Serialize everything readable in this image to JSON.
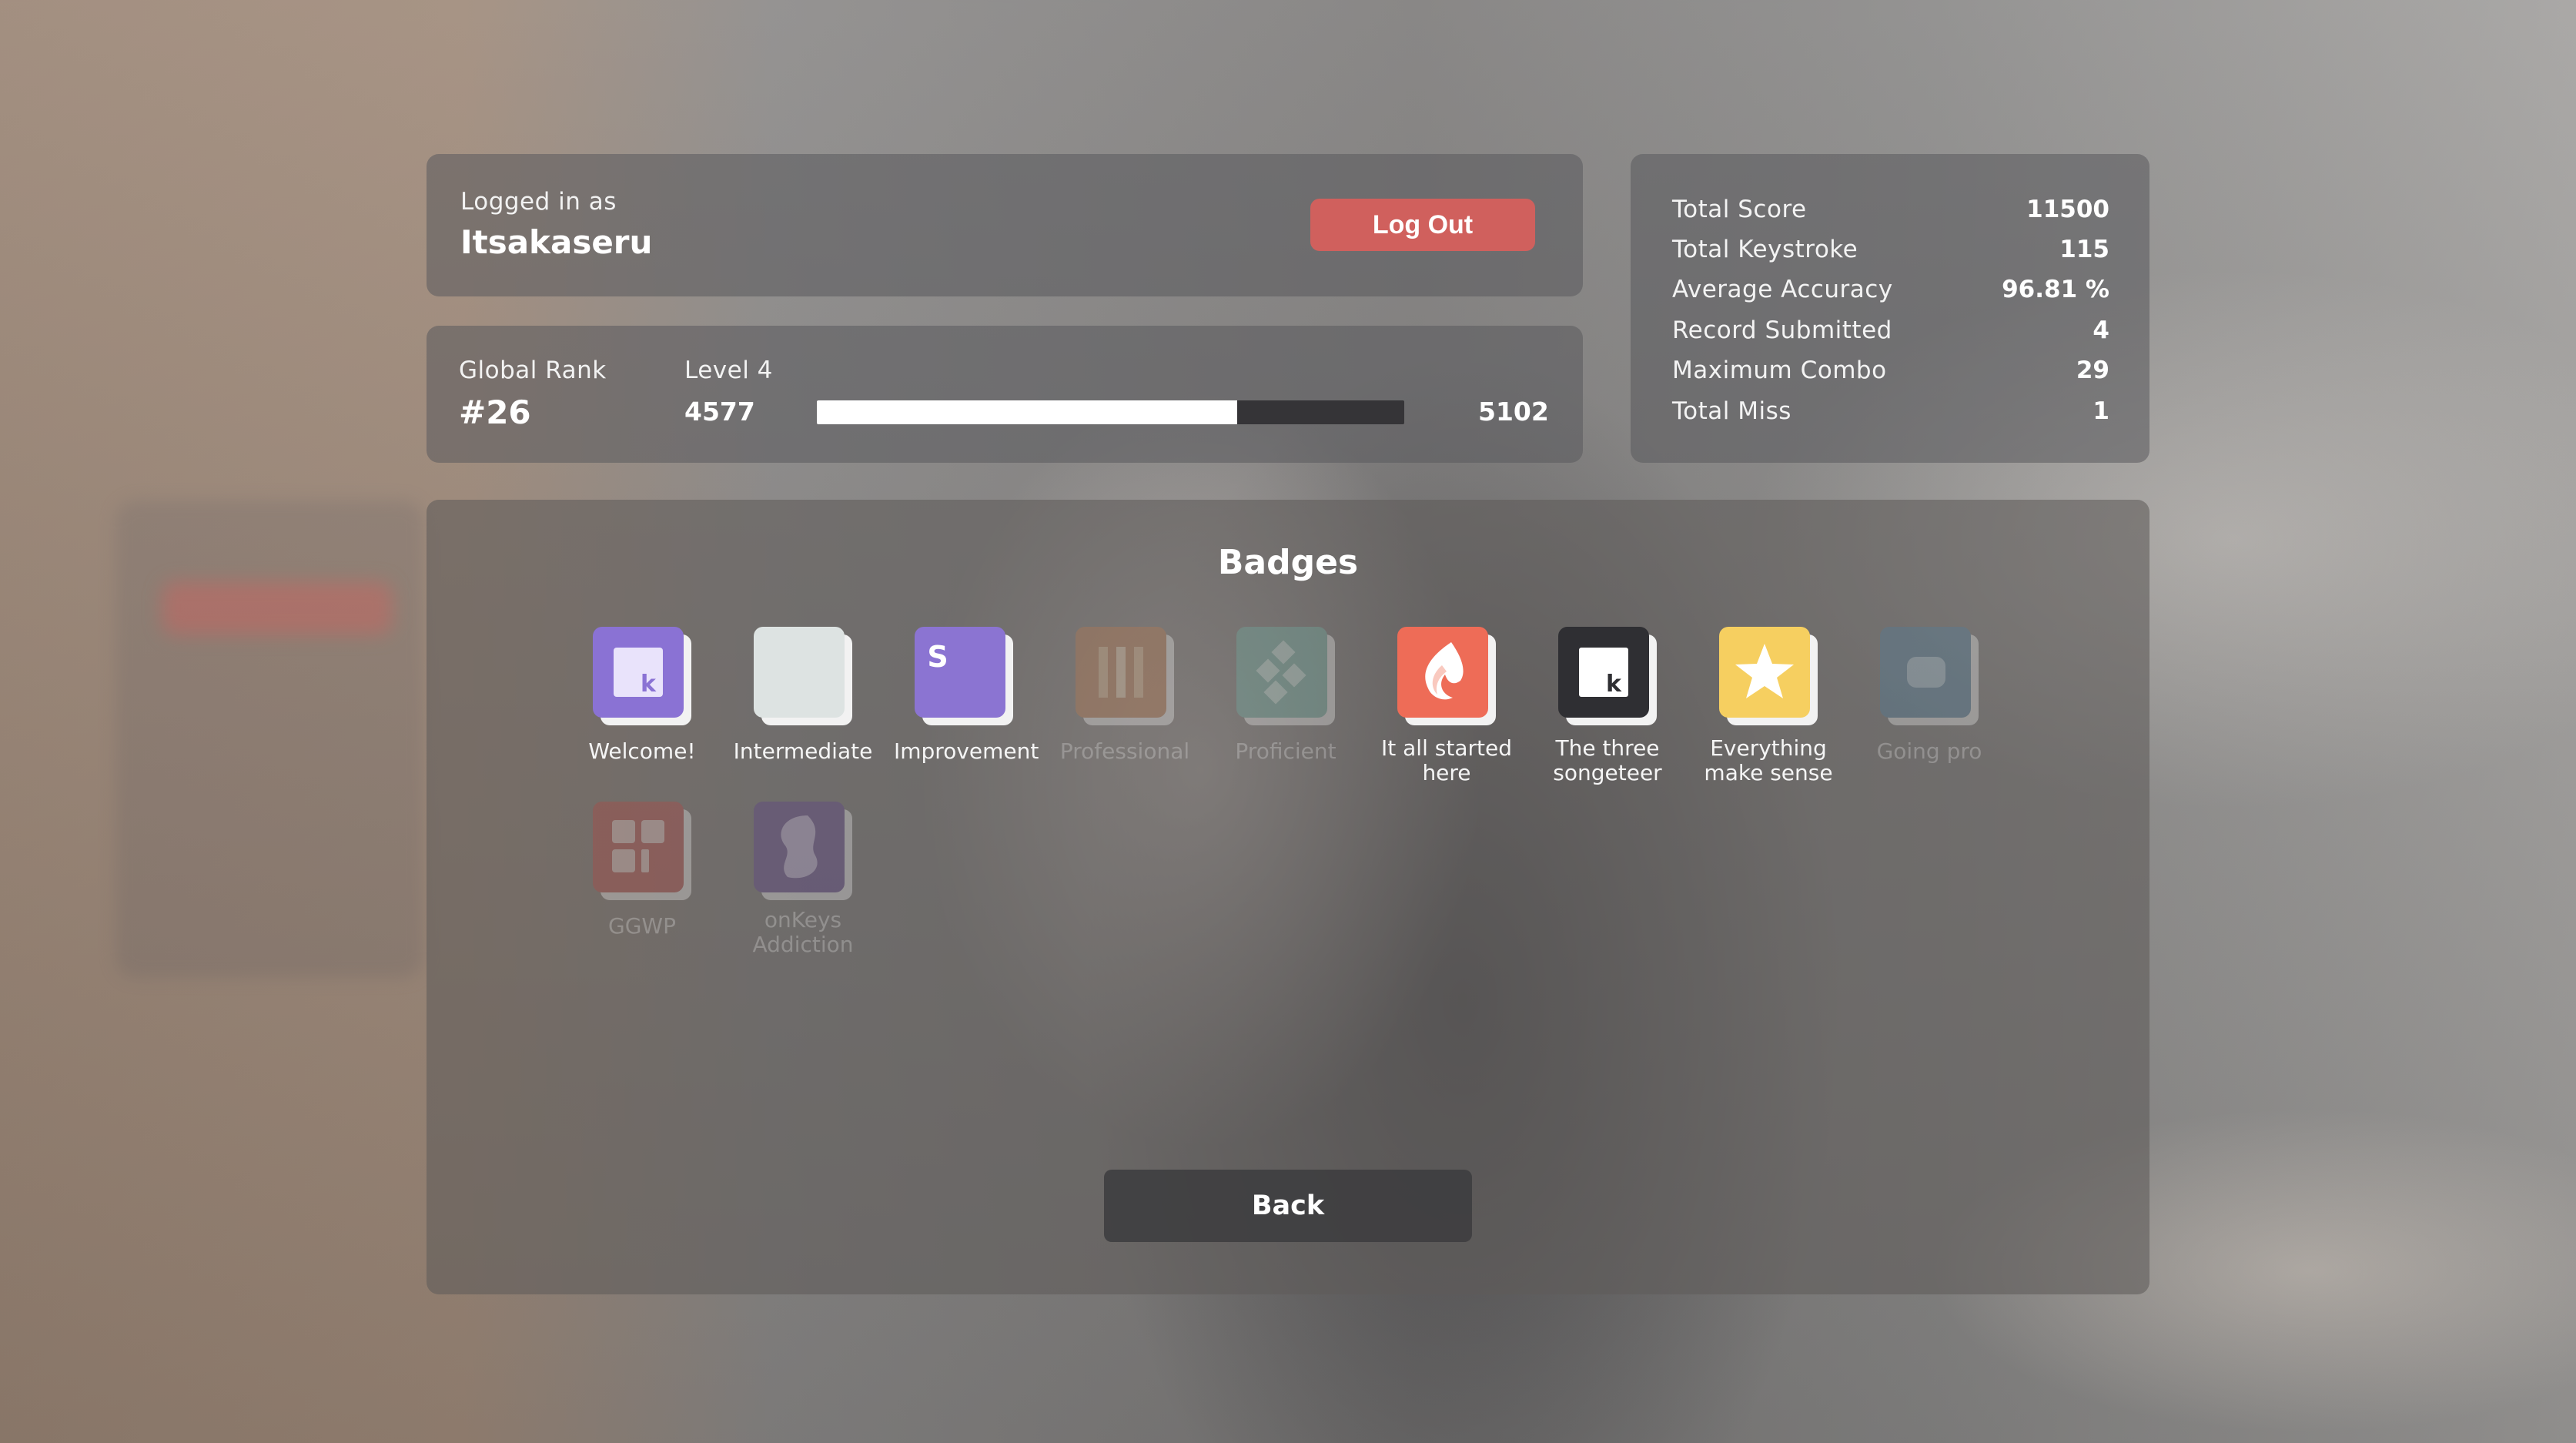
{
  "user": {
    "logged_in_label": "Logged in as",
    "username": "Itsakaseru",
    "logout_label": "Log Out"
  },
  "rank": {
    "global_rank_label": "Global Rank",
    "global_rank_value": "#26",
    "level_label": "Level 4",
    "level_current": "4577",
    "level_next": "5102",
    "progress_fraction": 0.715
  },
  "stats": [
    {
      "label": "Total Score",
      "value": "11500"
    },
    {
      "label": "Total Keystroke",
      "value": "115"
    },
    {
      "label": "Average Accuracy",
      "value": "96.81 %"
    },
    {
      "label": "Record Submitted",
      "value": "4"
    },
    {
      "label": "Maximum Combo",
      "value": "29"
    },
    {
      "label": "Total Miss",
      "value": "1"
    }
  ],
  "badges": {
    "title": "Badges",
    "items": [
      {
        "name": "Welcome!",
        "icon": "key-k-icon",
        "color": "#8a72d4",
        "unlocked": true
      },
      {
        "name": "Intermediate",
        "icon": "blank-icon",
        "color": "#dde3e2",
        "unlocked": true
      },
      {
        "name": "Improvement",
        "icon": "letter-s-icon",
        "color": "#8b74d2",
        "unlocked": true
      },
      {
        "name": "Professional",
        "icon": "bars-icon",
        "color": "#c07a4a",
        "unlocked": false
      },
      {
        "name": "Proficient",
        "icon": "diamond-cluster-icon",
        "color": "#6fb3a6",
        "unlocked": false
      },
      {
        "name": "It all started here",
        "icon": "flame-icon",
        "color": "#ee6c57",
        "unlocked": true
      },
      {
        "name": "The three songeteer",
        "icon": "key-k-icon",
        "color": "#2f2f33",
        "unlocked": true
      },
      {
        "name": "Everything make sense",
        "icon": "star-icon",
        "color": "#f6cf60",
        "unlocked": true
      },
      {
        "name": "Going pro",
        "icon": "rounded-square-icon",
        "color": "#4d7fa0",
        "unlocked": false
      },
      {
        "name": "GGWP",
        "icon": "grid-icon",
        "color": "#b9433f",
        "unlocked": false
      },
      {
        "name": "onKeys Addiction",
        "icon": "swirl-icon",
        "color": "#5b3b8c",
        "unlocked": false
      }
    ]
  },
  "back_label": "Back"
}
